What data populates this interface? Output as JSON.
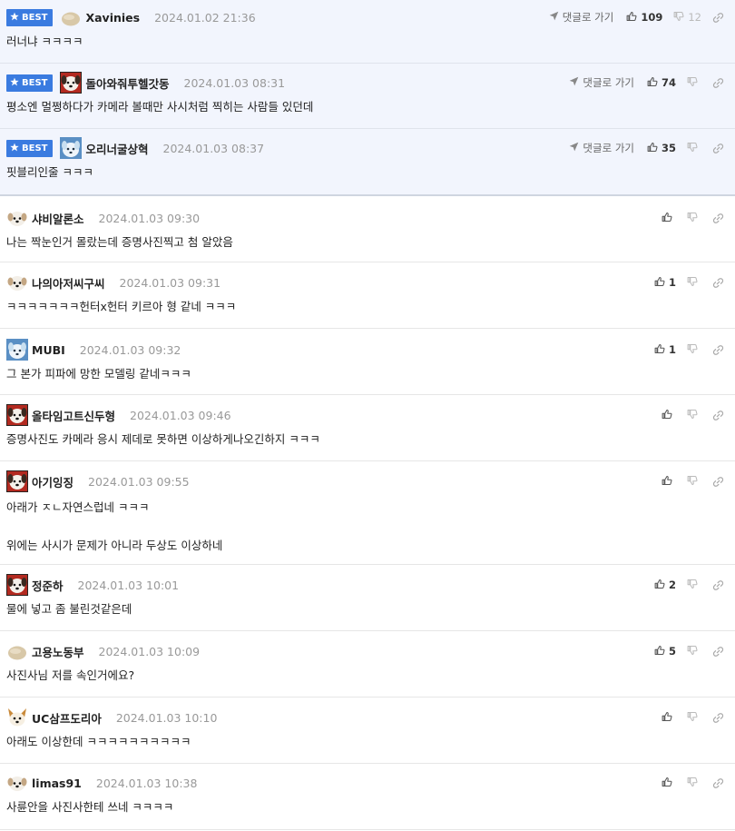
{
  "labels": {
    "best": "BEST",
    "reply_link": "댓글로 가기"
  },
  "colors": {
    "best_bg": "#f2f5fd",
    "best_badge": "#3a7be0"
  },
  "comments": [
    {
      "best": true,
      "avatar": "avatar-beige",
      "nick": "Xavinies",
      "date": "2024.01.02 21:36",
      "text": "러너냐 ㅋㅋㅋㅋ",
      "likes": "109",
      "dislikes": "12",
      "show_reply": true
    },
    {
      "best": true,
      "avatar": "avatar-dog-red",
      "nick": "돌아와줘투헬갓동",
      "date": "2024.01.03 08:31",
      "text": "평소엔 멀쩡하다가 카메라 볼때만 사시처럼 찍히는 사람들 있던데",
      "likes": "74",
      "dislikes": "",
      "show_reply": true
    },
    {
      "best": true,
      "avatar": "avatar-blue",
      "nick": "오리너굴상혁",
      "date": "2024.01.03 08:37",
      "text": "핏블리인줄 ㅋㅋㅋ",
      "likes": "35",
      "dislikes": "",
      "show_reply": true
    },
    {
      "best": false,
      "avatar": "avatar-dog",
      "nick": "샤비알론소",
      "date": "2024.01.03 09:30",
      "text": "나는 짝눈인거 몰랐는데 증명사진찍고 첨 알았음",
      "likes": "",
      "dislikes": "",
      "show_reply": false
    },
    {
      "best": false,
      "avatar": "avatar-dog",
      "nick": "나의아저씨구씨",
      "date": "2024.01.03 09:31",
      "text": "ㅋㅋㅋㅋㅋㅋㅋ헌터x헌터 키르아 형 같네 ㅋㅋㅋ",
      "likes": "1",
      "dislikes": "",
      "show_reply": false
    },
    {
      "best": false,
      "avatar": "avatar-blue",
      "nick": "MUBI",
      "date": "2024.01.03 09:32",
      "text": "그 본가 피파에 망한 모델링 같네ㅋㅋㅋ",
      "likes": "1",
      "dislikes": "",
      "show_reply": false
    },
    {
      "best": false,
      "avatar": "avatar-dog-red",
      "nick": "올타임고트신두형",
      "date": "2024.01.03 09:46",
      "text": "증명사진도 카메라 응시 제데로 못하면 이상하게나오긴하지 ㅋㅋㅋ",
      "likes": "",
      "dislikes": "",
      "show_reply": false
    },
    {
      "best": false,
      "avatar": "avatar-dog-red",
      "nick": "아기잉징",
      "date": "2024.01.03 09:55",
      "text": "아래가 ㅈㄴ자연스럽네 ㅋㅋㅋ\n\n위에는 사시가 문제가 아니라 두상도 이상하네",
      "likes": "",
      "dislikes": "",
      "show_reply": false
    },
    {
      "best": false,
      "avatar": "avatar-dog-red",
      "nick": "정준하",
      "date": "2024.01.03 10:01",
      "text": "물에 넣고 좀 불린것같은데",
      "likes": "2",
      "dislikes": "",
      "show_reply": false
    },
    {
      "best": false,
      "avatar": "avatar-beige",
      "nick": "고용노동부",
      "date": "2024.01.03 10:09",
      "text": "사진사님 저를 속인거에요?",
      "likes": "5",
      "dislikes": "",
      "show_reply": false
    },
    {
      "best": false,
      "avatar": "avatar-fox",
      "nick": "UC삼프도리아",
      "date": "2024.01.03 10:10",
      "text": "아래도 이상한데 ㅋㅋㅋㅋㅋㅋㅋㅋㅋㅋ",
      "likes": "",
      "dislikes": "",
      "show_reply": false
    },
    {
      "best": false,
      "avatar": "avatar-dog",
      "nick": "limas91",
      "date": "2024.01.03 10:38",
      "text": "사륜안을 사진사한테 쓰네 ㅋㅋㅋㅋ",
      "likes": "",
      "dislikes": "",
      "show_reply": false
    }
  ]
}
